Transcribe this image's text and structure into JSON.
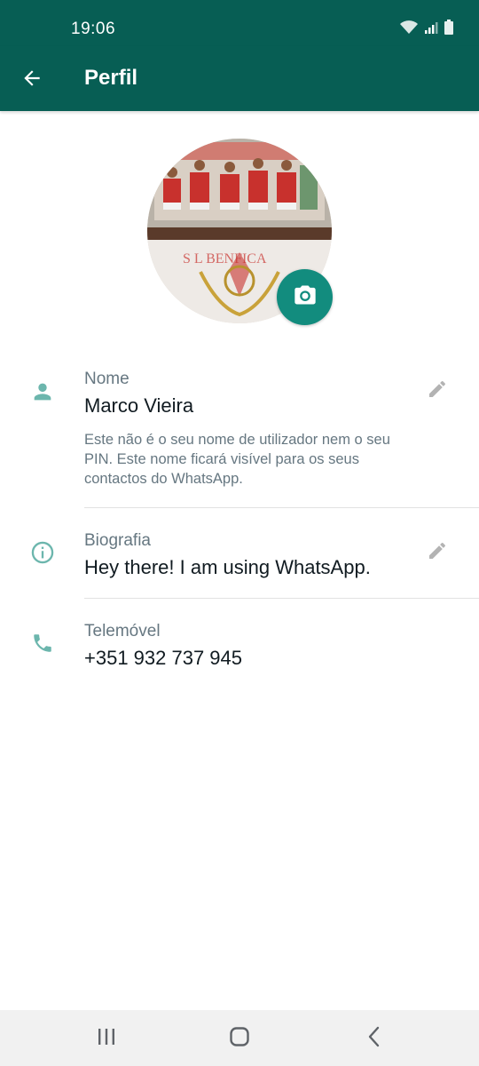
{
  "status_bar": {
    "time": "19:06"
  },
  "app_bar": {
    "title": "Perfil"
  },
  "profile": {
    "name": {
      "label": "Nome",
      "value": "Marco Vieira",
      "help": "Este não é o seu nome de utilizador nem o seu PIN. Este nome ficará visível para os seus contactos do WhatsApp."
    },
    "about": {
      "label": "Biografia",
      "value": "Hey there! I am using WhatsApp."
    },
    "phone": {
      "label": "Telemóvel",
      "value": "+351 932 737 945"
    }
  },
  "icons": {
    "back": "arrow-left-icon",
    "camera": "camera-icon",
    "person": "person-icon",
    "info": "info-icon",
    "phone": "phone-icon",
    "edit": "pencil-icon",
    "nav_recents": "recents-icon",
    "nav_home": "home-icon",
    "nav_back": "chevron-left-icon"
  },
  "colors": {
    "header": "#075e54",
    "accent": "#128c7e",
    "icon_teal": "#6cb6ad",
    "secondary_text": "#667781",
    "primary_text": "#111b21"
  }
}
